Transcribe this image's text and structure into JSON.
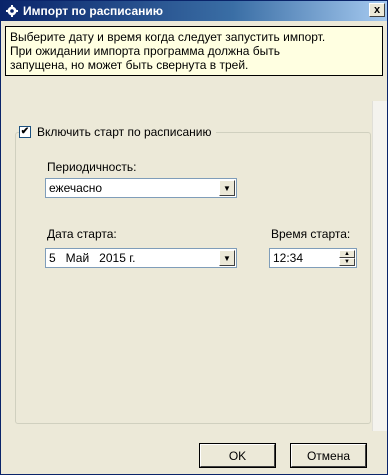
{
  "window": {
    "title": "Импорт по расписанию",
    "close_glyph": "x",
    "title_icon": "gear-icon"
  },
  "info": {
    "text": "Выберите дату и время когда следует запустить импорт.\nПри ожидании импорта программа должна быть\nзапущена, но может быть свернута в трей."
  },
  "schedule": {
    "enable_label": "Включить старт по расписанию",
    "enable_checked": true,
    "check_glyph": "✔",
    "periodicity_label": "Периодичность:",
    "periodicity_value": "ежечасно",
    "start_date_label": "Дата старта:",
    "start_date_value": "5   Май   2015 г.",
    "start_time_label": "Время старта:",
    "start_time_value": "12:34"
  },
  "glyphs": {
    "dropdown": "▼",
    "spin_up": "▲",
    "spin_down": "▼"
  },
  "buttons": {
    "ok": "OK",
    "cancel": "Отмена"
  },
  "colors": {
    "title_bar": "#0a246a",
    "info_bg": "#ffffe1",
    "face": "#ece9d8"
  }
}
